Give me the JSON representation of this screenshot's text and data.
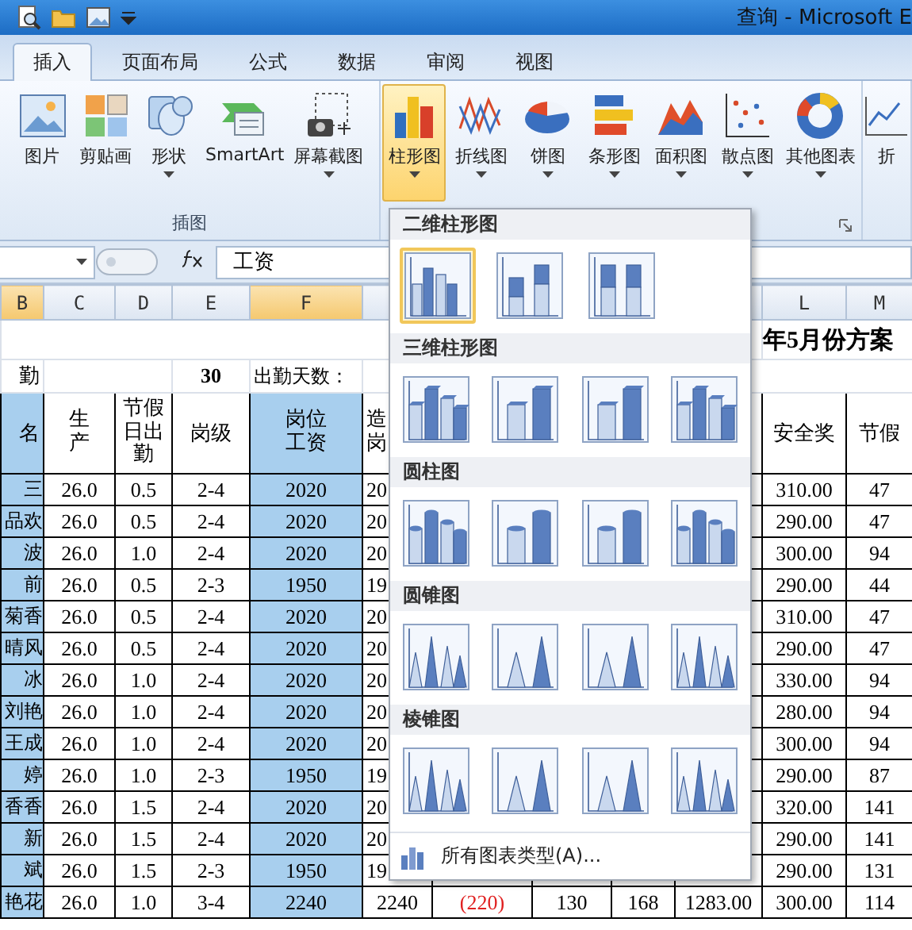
{
  "window": {
    "title": "查询 - Microsoft E"
  },
  "tabs": [
    {
      "label": "插入",
      "selected": true
    },
    {
      "label": "页面布局",
      "selected": false
    },
    {
      "label": "公式",
      "selected": false
    },
    {
      "label": "数据",
      "selected": false
    },
    {
      "label": "审阅",
      "selected": false
    },
    {
      "label": "视图",
      "selected": false
    }
  ],
  "ribbon": {
    "illustrations": {
      "label": "插图",
      "buttons": [
        {
          "label": "图片",
          "kind": "picture",
          "dropdown": false
        },
        {
          "label": "剪贴画",
          "kind": "clipart",
          "dropdown": false
        },
        {
          "label": "形状",
          "kind": "shapes",
          "dropdown": true
        },
        {
          "label": "SmartArt",
          "kind": "smartart",
          "dropdown": false
        },
        {
          "label": "屏幕截图",
          "kind": "screenshot",
          "dropdown": true
        }
      ]
    },
    "charts": {
      "buttons": [
        {
          "label": "柱形图",
          "kind": "column",
          "dropdown": true,
          "selected": true
        },
        {
          "label": "折线图",
          "kind": "line",
          "dropdown": true,
          "selected": false
        },
        {
          "label": "饼图",
          "kind": "pie",
          "dropdown": true,
          "selected": false
        },
        {
          "label": "条形图",
          "kind": "bar",
          "dropdown": true,
          "selected": false
        },
        {
          "label": "面积图",
          "kind": "area",
          "dropdown": true,
          "selected": false
        },
        {
          "label": "散点图",
          "kind": "scatter",
          "dropdown": true,
          "selected": false
        },
        {
          "label": "其他图表",
          "kind": "other",
          "dropdown": true,
          "selected": false
        }
      ]
    },
    "sparklines": {
      "label": "折",
      "kind": "sparkline"
    }
  },
  "formula_bar": {
    "formula": "工资"
  },
  "sheet": {
    "columns": [
      {
        "label": "B",
        "selected": true
      },
      {
        "label": "C",
        "selected": false
      },
      {
        "label": "D",
        "selected": false
      },
      {
        "label": "E",
        "selected": false
      },
      {
        "label": "F",
        "selected": true
      },
      {
        "label": "L",
        "selected": false
      },
      {
        "label": "M",
        "selected": false
      }
    ],
    "title": "年5月份方案",
    "info": {
      "label": "勤",
      "days": "30",
      "days_label": "出勤天数："
    },
    "header": {
      "B": "名",
      "C": "生产",
      "D": "节假日出勤",
      "E": "岗级",
      "F": "岗位工资",
      "G": "造岗",
      "L": "安全奖",
      "M": "节假"
    },
    "rows": [
      {
        "B": "三",
        "C": "26.0",
        "D": "0.5",
        "E": "2-4",
        "F": "2020",
        "G": "20",
        "L": "310.00",
        "M": "47"
      },
      {
        "B": "品欢",
        "C": "26.0",
        "D": "0.5",
        "E": "2-4",
        "F": "2020",
        "G": "20",
        "L": "290.00",
        "M": "47"
      },
      {
        "B": "波",
        "C": "26.0",
        "D": "1.0",
        "E": "2-4",
        "F": "2020",
        "G": "20",
        "L": "300.00",
        "M": "94"
      },
      {
        "B": "前",
        "C": "26.0",
        "D": "0.5",
        "E": "2-3",
        "F": "1950",
        "G": "19",
        "L": "290.00",
        "M": "44"
      },
      {
        "B": "菊香",
        "C": "26.0",
        "D": "0.5",
        "E": "2-4",
        "F": "2020",
        "G": "20",
        "L": "310.00",
        "M": "47"
      },
      {
        "B": "晴风",
        "C": "26.0",
        "D": "0.5",
        "E": "2-4",
        "F": "2020",
        "G": "20",
        "L": "290.00",
        "M": "47"
      },
      {
        "B": "冰",
        "C": "26.0",
        "D": "1.0",
        "E": "2-4",
        "F": "2020",
        "G": "20",
        "L": "330.00",
        "M": "94"
      },
      {
        "B": "刘艳",
        "C": "26.0",
        "D": "1.0",
        "E": "2-4",
        "F": "2020",
        "G": "20",
        "L": "280.00",
        "M": "94"
      },
      {
        "B": "王成",
        "C": "26.0",
        "D": "1.0",
        "E": "2-4",
        "F": "2020",
        "G": "20",
        "L": "300.00",
        "M": "94"
      },
      {
        "B": "婷",
        "C": "26.0",
        "D": "1.0",
        "E": "2-3",
        "F": "1950",
        "G": "19",
        "L": "290.00",
        "M": "87"
      },
      {
        "B": "香香",
        "C": "26.0",
        "D": "1.5",
        "E": "2-4",
        "F": "2020",
        "G": "20",
        "L": "320.00",
        "M": "141"
      },
      {
        "B": "新",
        "C": "26.0",
        "D": "1.5",
        "E": "2-4",
        "F": "2020",
        "G": "20",
        "L": "290.00",
        "M": "141"
      },
      {
        "B": "斌",
        "C": "26.0",
        "D": "1.5",
        "E": "2-3",
        "F": "1950",
        "G": "19",
        "L": "290.00",
        "M": "131"
      },
      {
        "B": "艳花",
        "C": "26.0",
        "D": "1.0",
        "E": "3-4",
        "F": "2240",
        "G": "2240",
        "H": {
          "text": "(220)",
          "negative": true
        },
        "I": "130",
        "J": "168",
        "K": "1283.00",
        "L": "300.00",
        "M": "114"
      }
    ]
  },
  "chart_menu": {
    "sections": [
      {
        "title": "二维柱形图",
        "kind": "column",
        "items": [
          {
            "selected": true
          },
          {
            "selected": false
          },
          {
            "selected": false
          }
        ]
      },
      {
        "title": "三维柱形图",
        "kind": "column3d",
        "items": [
          {
            "selected": false
          },
          {
            "selected": false
          },
          {
            "selected": false
          },
          {
            "selected": false
          }
        ]
      },
      {
        "title": "圆柱图",
        "kind": "cylinder",
        "items": [
          {
            "selected": false
          },
          {
            "selected": false
          },
          {
            "selected": false
          },
          {
            "selected": false
          }
        ]
      },
      {
        "title": "圆锥图",
        "kind": "cone",
        "items": [
          {
            "selected": false
          },
          {
            "selected": false
          },
          {
            "selected": false
          },
          {
            "selected": false
          }
        ]
      },
      {
        "title": "棱锥图",
        "kind": "pyramid",
        "items": [
          {
            "selected": false
          },
          {
            "selected": false
          },
          {
            "selected": false
          },
          {
            "selected": false
          }
        ]
      }
    ],
    "footer": "所有图表类型(A)..."
  }
}
